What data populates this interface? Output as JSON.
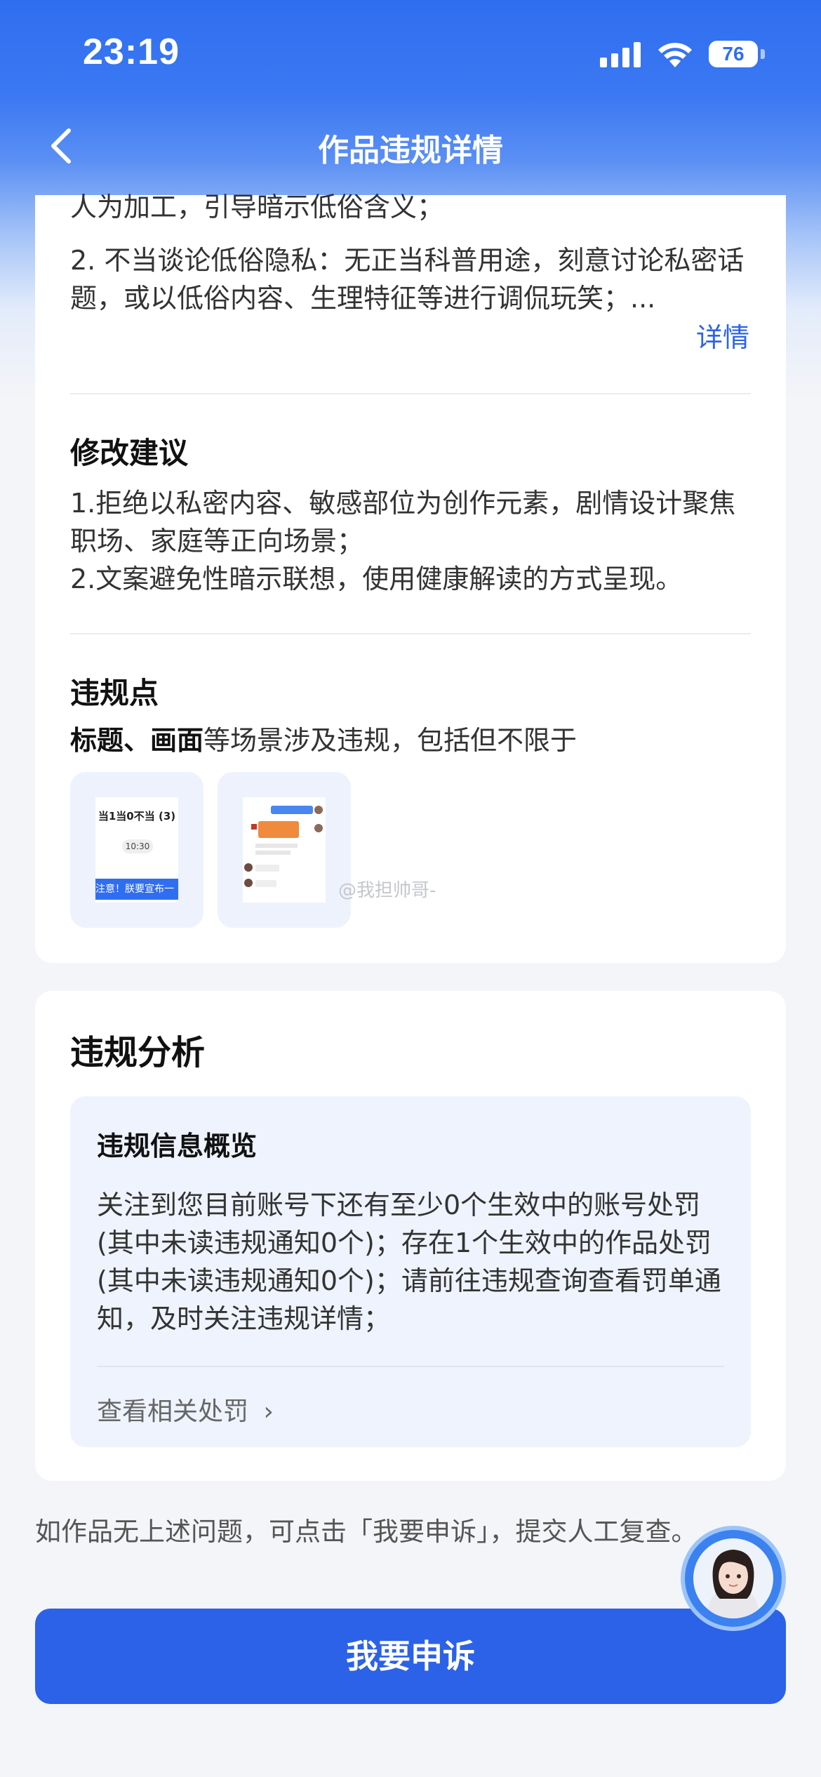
{
  "status_bar": {
    "time": "23:19",
    "battery": "76"
  },
  "nav": {
    "title": "作品违规详情"
  },
  "violation_reason": {
    "line_top": "人为加工，引导暗示低俗含义；",
    "item2": "2. 不当谈论低俗隐私：无正当科普用途，刻意讨论私密话题，或以低俗内容、生理特征等进行调侃玩笑；...",
    "detail_link": "详情"
  },
  "suggestion": {
    "title": "修改建议",
    "text1": "1.拒绝以私密内容、敏感部位为创作元素，剧情设计聚焦职场、家庭等正向场景；",
    "text2": "2.文案避免性暗示联想，使用健康解读的方式呈现。"
  },
  "violation_points": {
    "title": "违规点",
    "highlight": "标题、画面",
    "rest": "等场景涉及违规，包括但不限于",
    "thumb1": {
      "line1": "当1当0不当 (3)",
      "time": "10:30",
      "bar": "注意！朕要宣布一"
    }
  },
  "watermark": "@我担帅哥-",
  "analysis": {
    "title": "违规分析",
    "overview_title": "违规信息概览",
    "overview_text": "关注到您目前账号下还有至少0个生效中的账号处罚(其中未读违规通知0个)；存在1个生效中的作品处罚(其中未读违规通知0个)；请前往违规查询查看罚单通知，及时关注违规详情；",
    "link": "查看相关处罚"
  },
  "footer": {
    "note": "如作品无上述问题，可点击「我要申诉」，提交人工复查。",
    "appeal_button": "我要申诉"
  },
  "colors": {
    "primary": "#2c62e8",
    "link": "#2c64e6",
    "box_bg": "#eef3fd"
  }
}
